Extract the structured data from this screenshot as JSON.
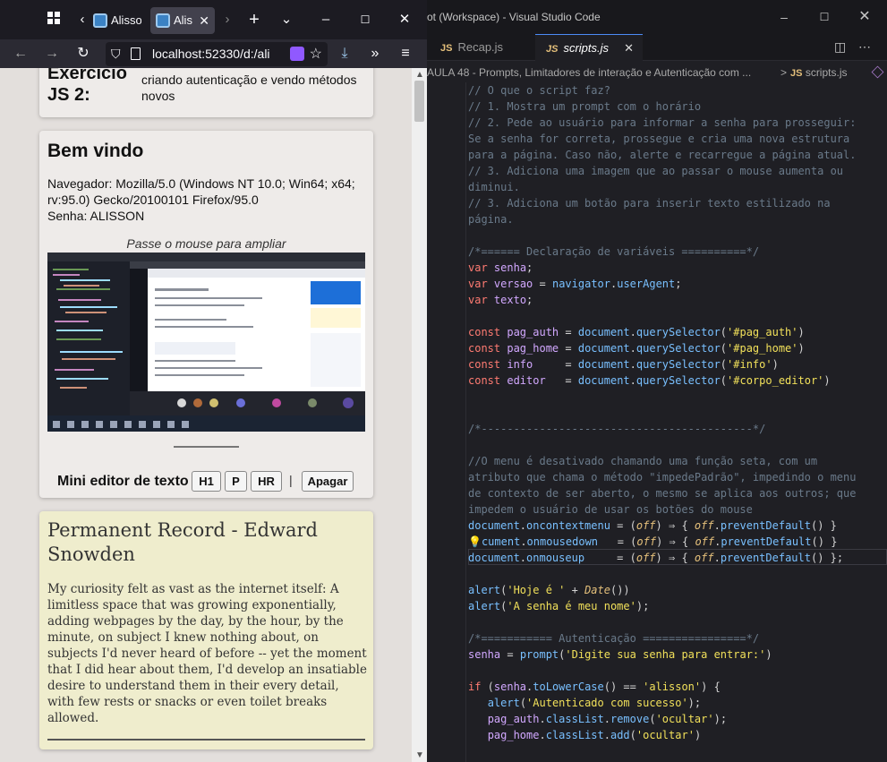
{
  "firefox": {
    "tab1_label": "Alisso",
    "tab2_label": "Alis",
    "url": "localhost:52330/d:/ali",
    "card1": {
      "heading": "Exercício JS 2:",
      "desc": "criando autenticação e vendo métodos novos"
    },
    "card2": {
      "title": "Bem vindo",
      "nav_line1": "Navegador: Mozilla/5.0 (Windows NT 10.0; Win64; x64;",
      "nav_line2": "rv:95.0) Gecko/20100101 Firefox/95.0",
      "senha_line": "Senha: ALISSON",
      "hint": "Passe o mouse para ampliar"
    },
    "editor": {
      "label": "Mini editor de texto",
      "buttons": [
        "H1",
        "P",
        "HR"
      ],
      "separator": "|",
      "clear": "Apagar"
    },
    "card3": {
      "title": "Permanent Record - Edward Snowden",
      "text": "My curiosity felt as vast as the internet itself: A limitless space that was growing exponentially, adding webpages by the day, by the hour, by the minute, on subject I knew nothing about, on subjects I'd never heard of before -- yet the moment that I did hear about them, I'd develop an insatiable desire to understand them in their every detail, with few rests or snacks or even toilet breaks allowed."
    }
  },
  "vscode": {
    "title": "ot (Workspace) - Visual Studio Code",
    "tabs": [
      {
        "label": "Recap.js",
        "icon": "JS"
      },
      {
        "label": "scripts.js",
        "icon": "JS"
      }
    ],
    "breadcrumb": "AULA 48 - Prompts, Limitadores de interação e Autenticação com ...",
    "breadcrumb_sep": ">",
    "breadcrumb_file": "scripts.js",
    "breadcrumb_file_icon": "JS"
  }
}
